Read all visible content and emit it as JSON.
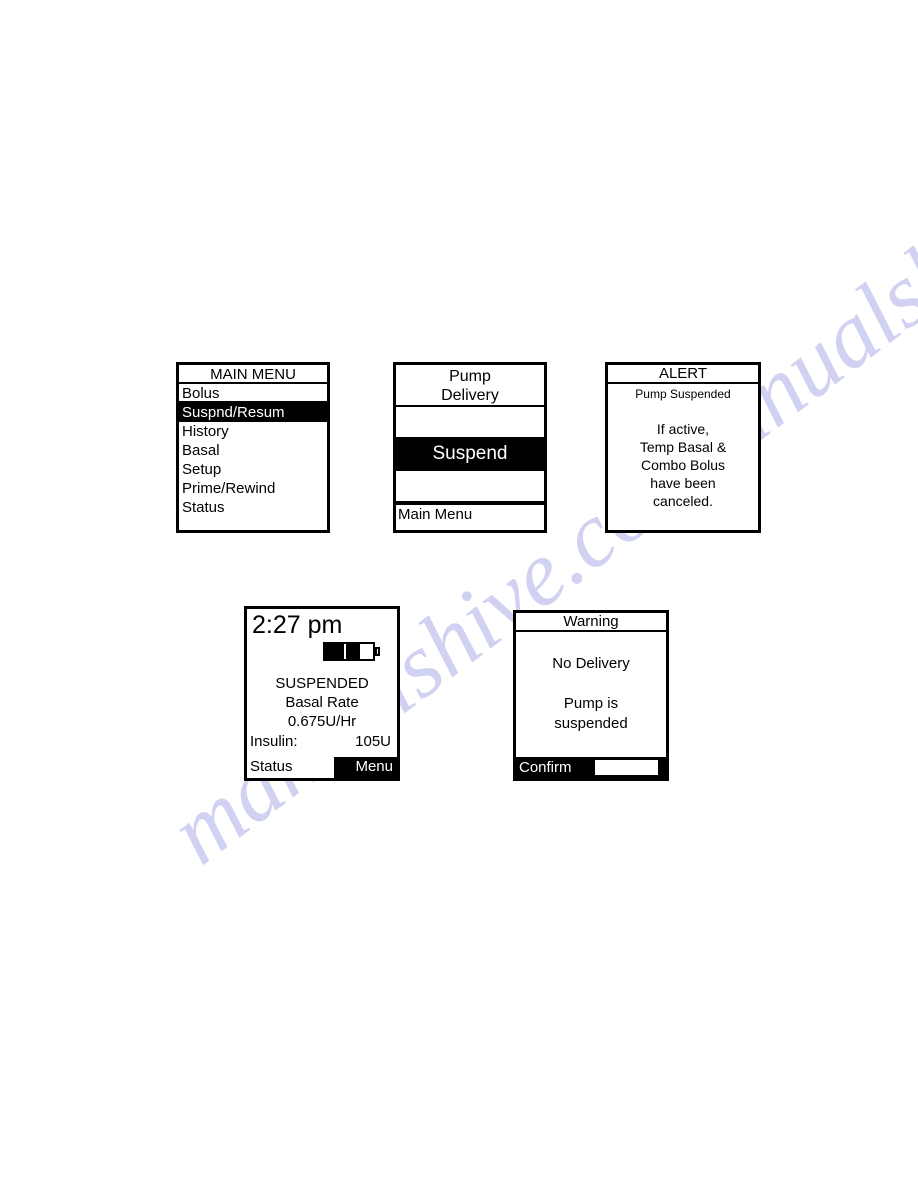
{
  "page": {
    "background_color": "#ffffff",
    "screen_border_color": "#000000",
    "highlight_color": "#000000",
    "highlight_text_color": "#ffffff"
  },
  "watermark": {
    "text_left": "manualshive.com",
    "text_right": "manualshive.com",
    "color": "#c9c9ef"
  },
  "screens": {
    "main_menu": {
      "title": "MAIN MENU",
      "items": [
        {
          "label": "Bolus",
          "selected": false
        },
        {
          "label": "Suspnd/Resum",
          "selected": true
        },
        {
          "label": "History",
          "selected": false
        },
        {
          "label": "Basal",
          "selected": false
        },
        {
          "label": "Setup",
          "selected": false
        },
        {
          "label": "Prime/Rewind",
          "selected": false
        },
        {
          "label": "Status",
          "selected": false
        }
      ]
    },
    "pump_delivery": {
      "header_line1": "Pump",
      "header_line2": "Delivery",
      "selected_option": "Suspend",
      "footer_label": "Main Menu"
    },
    "alert": {
      "title": "ALERT",
      "subtitle": "Pump Suspended",
      "body_line1": "If active,",
      "body_line2": "Temp Basal &",
      "body_line3": "Combo Bolus",
      "body_line4": "have been",
      "body_line5": "canceled."
    },
    "status": {
      "time": "2:27 pm",
      "battery_icon": "battery-icon",
      "battery_level_percent": 68,
      "state": "SUSPENDED",
      "basal_rate_label": "Basal Rate",
      "basal_rate_value": "0.675U/Hr",
      "insulin_label": "Insulin:",
      "insulin_value": "105U",
      "soft_left": "Status",
      "soft_right": "Menu"
    },
    "warning": {
      "title": "Warning",
      "body_line1": "No Delivery",
      "body_line2": "Pump is",
      "body_line3": "suspended",
      "soft_left": "Confirm"
    }
  }
}
